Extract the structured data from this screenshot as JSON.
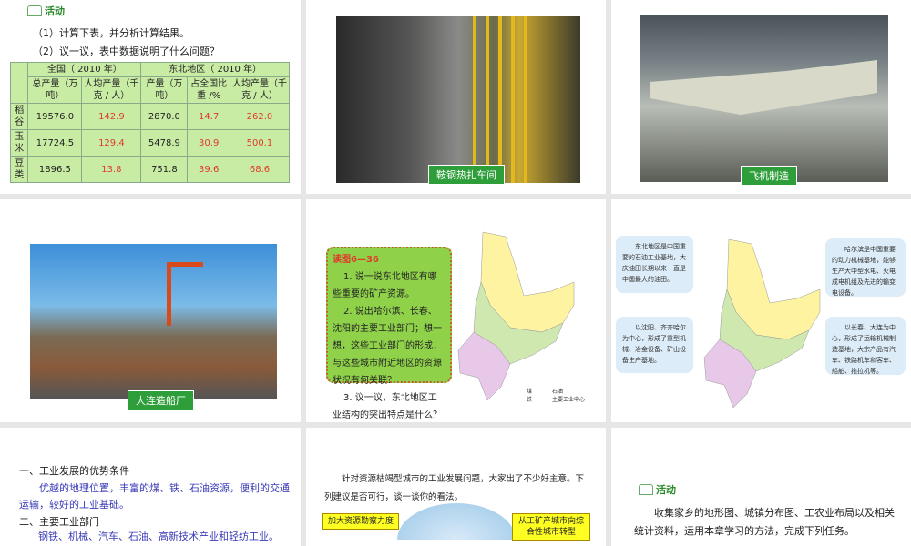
{
  "slide1": {
    "activity_label": "活动",
    "q1": "（1）计算下表，并分析计算结果。",
    "q2": "（2）议一议，表中数据说明了什么问题？",
    "table": {
      "group_national": "全国（ 2010 年）",
      "group_northeast": "东北地区（ 2010 年）",
      "cols": [
        "总产量（万吨）",
        "人均产量（千克 / 人）",
        "产量（万吨）",
        "占全国比重 /%",
        "人均产量（千克 / 人）"
      ],
      "rows": [
        [
          "稻谷",
          "19576.0",
          "142.9",
          "2870.0",
          "14.7",
          "262.0"
        ],
        [
          "玉米",
          "17724.5",
          "129.4",
          "5478.9",
          "30.9",
          "500.1"
        ],
        [
          "豆类",
          "1896.5",
          "13.8",
          "751.8",
          "39.6",
          "68.6"
        ]
      ]
    }
  },
  "slide2": {
    "caption": "鞍钢热扎车间"
  },
  "slide3": {
    "caption": "飞机制造"
  },
  "slide4": {
    "caption": "大连造船厂"
  },
  "slide5": {
    "title": "读图6—36",
    "items": [
      "1. 说一说东北地区有哪些重要的矿产资源。",
      "2. 说出哈尔滨、长春、沈阳的主要工业部门；想一想，这些工业部门的形成，与这些城市附近地区的资源状况有何关联？",
      "3. 议一议，东北地区工业结构的突出特点是什么？"
    ],
    "legend": [
      "煤",
      "石油",
      "铁",
      "主要工业中心"
    ]
  },
  "slide6": {
    "bubbles": [
      "东北地区是中国重要的石油工业基地，大庆油田长期以来一直是中国最大的油田。",
      "哈尔滨是中国重要的动力机械基地，能够生产大中型水电、火电成电机组及先进的输变电设备。",
      "以沈阳、齐齐哈尔为中心，形成了重型机械、冶金设备、矿山设备生产基地。",
      "以长春、大连为中心，形成了运输机械制造基地，大宗产品有汽车、铁路机车和客车、船舶、拖拉机等。"
    ]
  },
  "slide7": {
    "h1": "一、工业发展的优势条件",
    "p1": "优越的地理位置，丰富的煤、铁、石油资源，便利的交通运输，较好的工业基础。",
    "h2": "二、主要工业部门",
    "p2": "钢铁、机械、汽车、石油、高新技术产业和轻纺工业。"
  },
  "slide8": {
    "intro": "针对资源枯竭型城市的工业发展问题，大家出了不少好主意。下列建议是否可行，谈一谈你的看法。",
    "tag1": "加大资源勘察力度",
    "tag2": "从工矿产城市向综合性城市转型"
  },
  "slide9": {
    "activity_label": "活动",
    "text": "收集家乡的地形图、城镇分布图、工农业布局以及相关统计资料，运用本章学习的方法，完成下列任务。"
  }
}
